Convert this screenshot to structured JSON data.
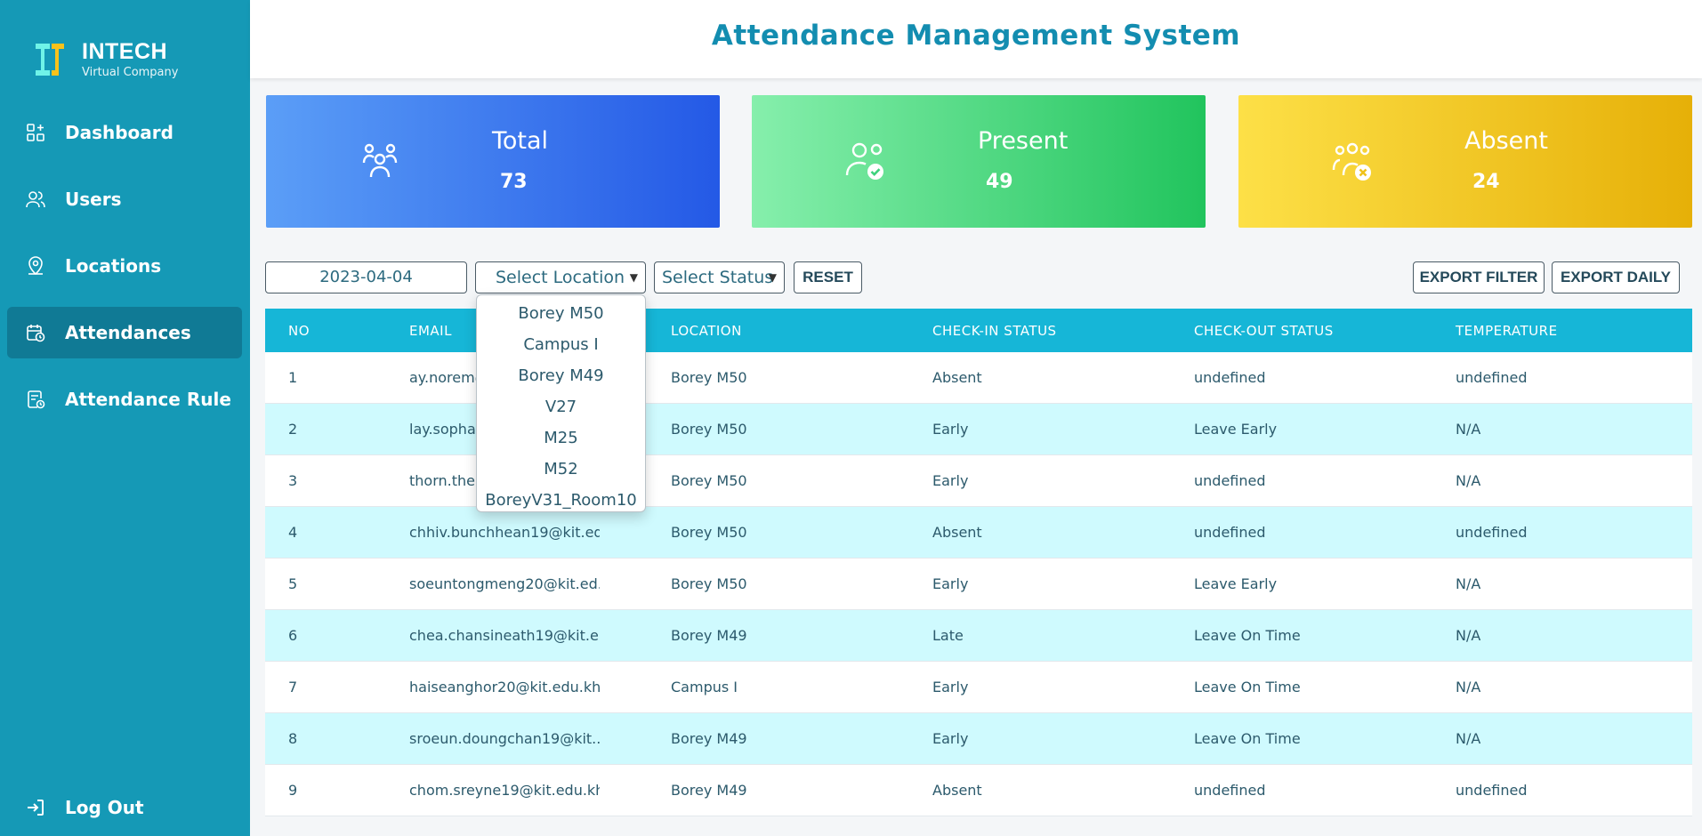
{
  "app": {
    "brand_name": "INTECH",
    "brand_sub": "Virtual Company",
    "page_title": "Attendance Management System"
  },
  "sidebar": {
    "items": [
      {
        "label": "Dashboard",
        "icon": "grid-plus-icon",
        "active": false
      },
      {
        "label": "Users",
        "icon": "users-icon",
        "active": false
      },
      {
        "label": "Locations",
        "icon": "map-pin-icon",
        "active": false
      },
      {
        "label": "Attendances",
        "icon": "calendar-clock-icon",
        "active": true
      },
      {
        "label": "Attendance Rule",
        "icon": "document-clock-icon",
        "active": false
      }
    ],
    "logout_label": "Log Out"
  },
  "cards": {
    "total": {
      "label": "Total",
      "value": "73"
    },
    "present": {
      "label": "Present",
      "value": "49"
    },
    "absent": {
      "label": "Absent",
      "value": "24"
    }
  },
  "filters": {
    "date": "2023-04-04",
    "location_label": "Select Location",
    "status_label": "Select Status",
    "reset_label": "RESET",
    "export_filter_label": "EXPORT FILTER",
    "export_daily_label": "EXPORT DAILY",
    "location_options": [
      "Borey M50",
      "Campus I",
      "Borey M49",
      "V27",
      "M25",
      "M52",
      "BoreyV31_Room10"
    ]
  },
  "table": {
    "headers": [
      "NO",
      "EMAIL",
      "LOCATION",
      "CHECK-IN STATUS",
      "CHECK-OUT STATUS",
      "TEMPERATURE"
    ],
    "rows": [
      [
        "1",
        "ay.norem@kit.edu.kh",
        "Borey M50",
        "Absent",
        "undefined",
        "undefined"
      ],
      [
        "2",
        "lay.sophanith@kit.edu.kh",
        "Borey M50",
        "Early",
        "Leave Early",
        "N/A"
      ],
      [
        "3",
        "thorn.thea@kit.edu.kh",
        "Borey M50",
        "Early",
        "undefined",
        "N/A"
      ],
      [
        "4",
        "chhiv.bunchhean19@kit.ed...",
        "Borey M50",
        "Absent",
        "undefined",
        "undefined"
      ],
      [
        "5",
        "soeuntongmeng20@kit.ed...",
        "Borey M50",
        "Early",
        "Leave Early",
        "N/A"
      ],
      [
        "6",
        "chea.chansineath19@kit.e...",
        "Borey M49",
        "Late",
        "Leave On Time",
        "N/A"
      ],
      [
        "7",
        "haiseanghor20@kit.edu.kh",
        "Campus I",
        "Early",
        "Leave On Time",
        "N/A"
      ],
      [
        "8",
        "sroeun.doungchan19@kit....",
        "Borey M49",
        "Early",
        "Leave On Time",
        "N/A"
      ],
      [
        "9",
        "chom.sreyne19@kit.edu.kh",
        "Borey M49",
        "Absent",
        "undefined",
        "undefined"
      ]
    ]
  },
  "colors": {
    "sidebar": "#1599b6",
    "sidebar_active": "#107a95",
    "title": "#138db0",
    "table_header": "#16b6d7",
    "row_alt": "#cffafe"
  }
}
